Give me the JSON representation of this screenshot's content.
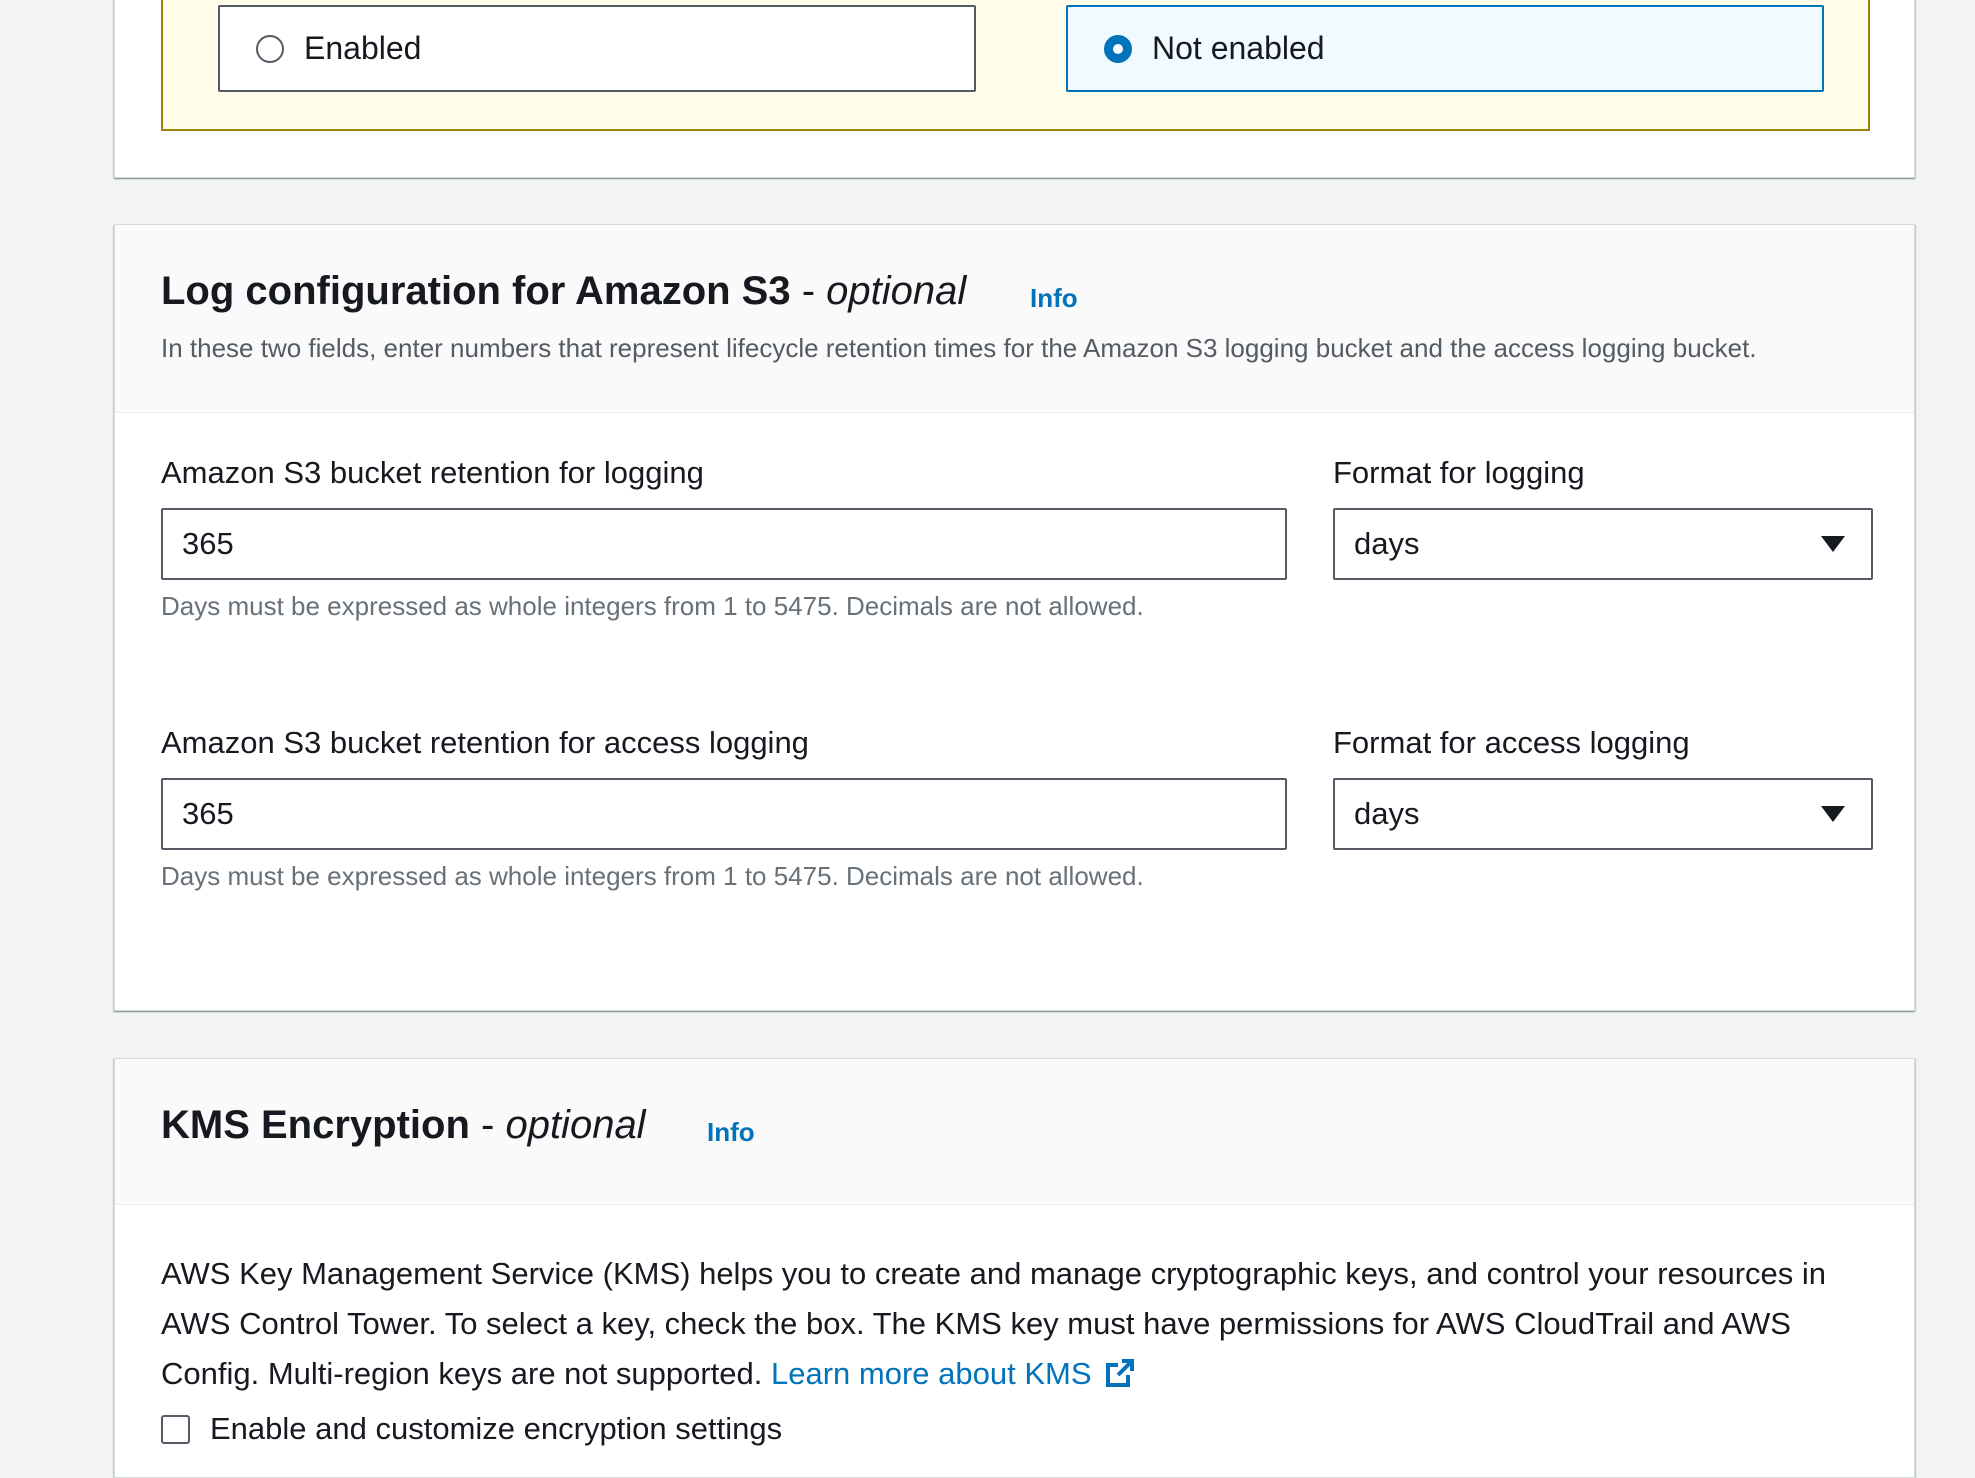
{
  "radio_group": {
    "options": [
      {
        "label": "Enabled",
        "selected": false
      },
      {
        "label": "Not enabled",
        "selected": true
      }
    ]
  },
  "log_config": {
    "title": "Log configuration for Amazon S3",
    "dash": " - ",
    "optional": "optional",
    "info": "Info",
    "description": "In these two fields, enter numbers that represent lifecycle retention times for the Amazon S3 logging bucket and the access logging bucket.",
    "logging": {
      "label": "Amazon S3 bucket retention for logging",
      "value": "365",
      "hint": "Days must be expressed as whole integers from 1 to 5475. Decimals are not allowed.",
      "format_label": "Format for logging",
      "format_value": "days"
    },
    "access_logging": {
      "label": "Amazon S3 bucket retention for access logging",
      "value": "365",
      "hint": "Days must be expressed as whole integers from 1 to 5475. Decimals are not allowed.",
      "format_label": "Format for access logging",
      "format_value": "days"
    }
  },
  "kms": {
    "title": "KMS Encryption",
    "dash": " - ",
    "optional": "optional",
    "info": "Info",
    "description": "AWS Key Management Service (KMS) helps you to create and manage cryptographic keys, and control your resources in AWS Control Tower. To select a key, check the box. The KMS key must have permissions for AWS CloudTrail and AWS Config. Multi-region keys are not supported.",
    "learn_more": "Learn more about KMS",
    "checkbox_label": "Enable and customize encryption settings"
  },
  "colors": {
    "accent": "#0073bb",
    "warning_border": "#9f8208",
    "warning_bg": "#fffce9",
    "page_bg": "#f2f3f3"
  },
  "icons": [
    "radio-unselected-icon",
    "radio-selected-icon",
    "caret-down-icon",
    "external-link-icon",
    "checkbox-icon"
  ]
}
